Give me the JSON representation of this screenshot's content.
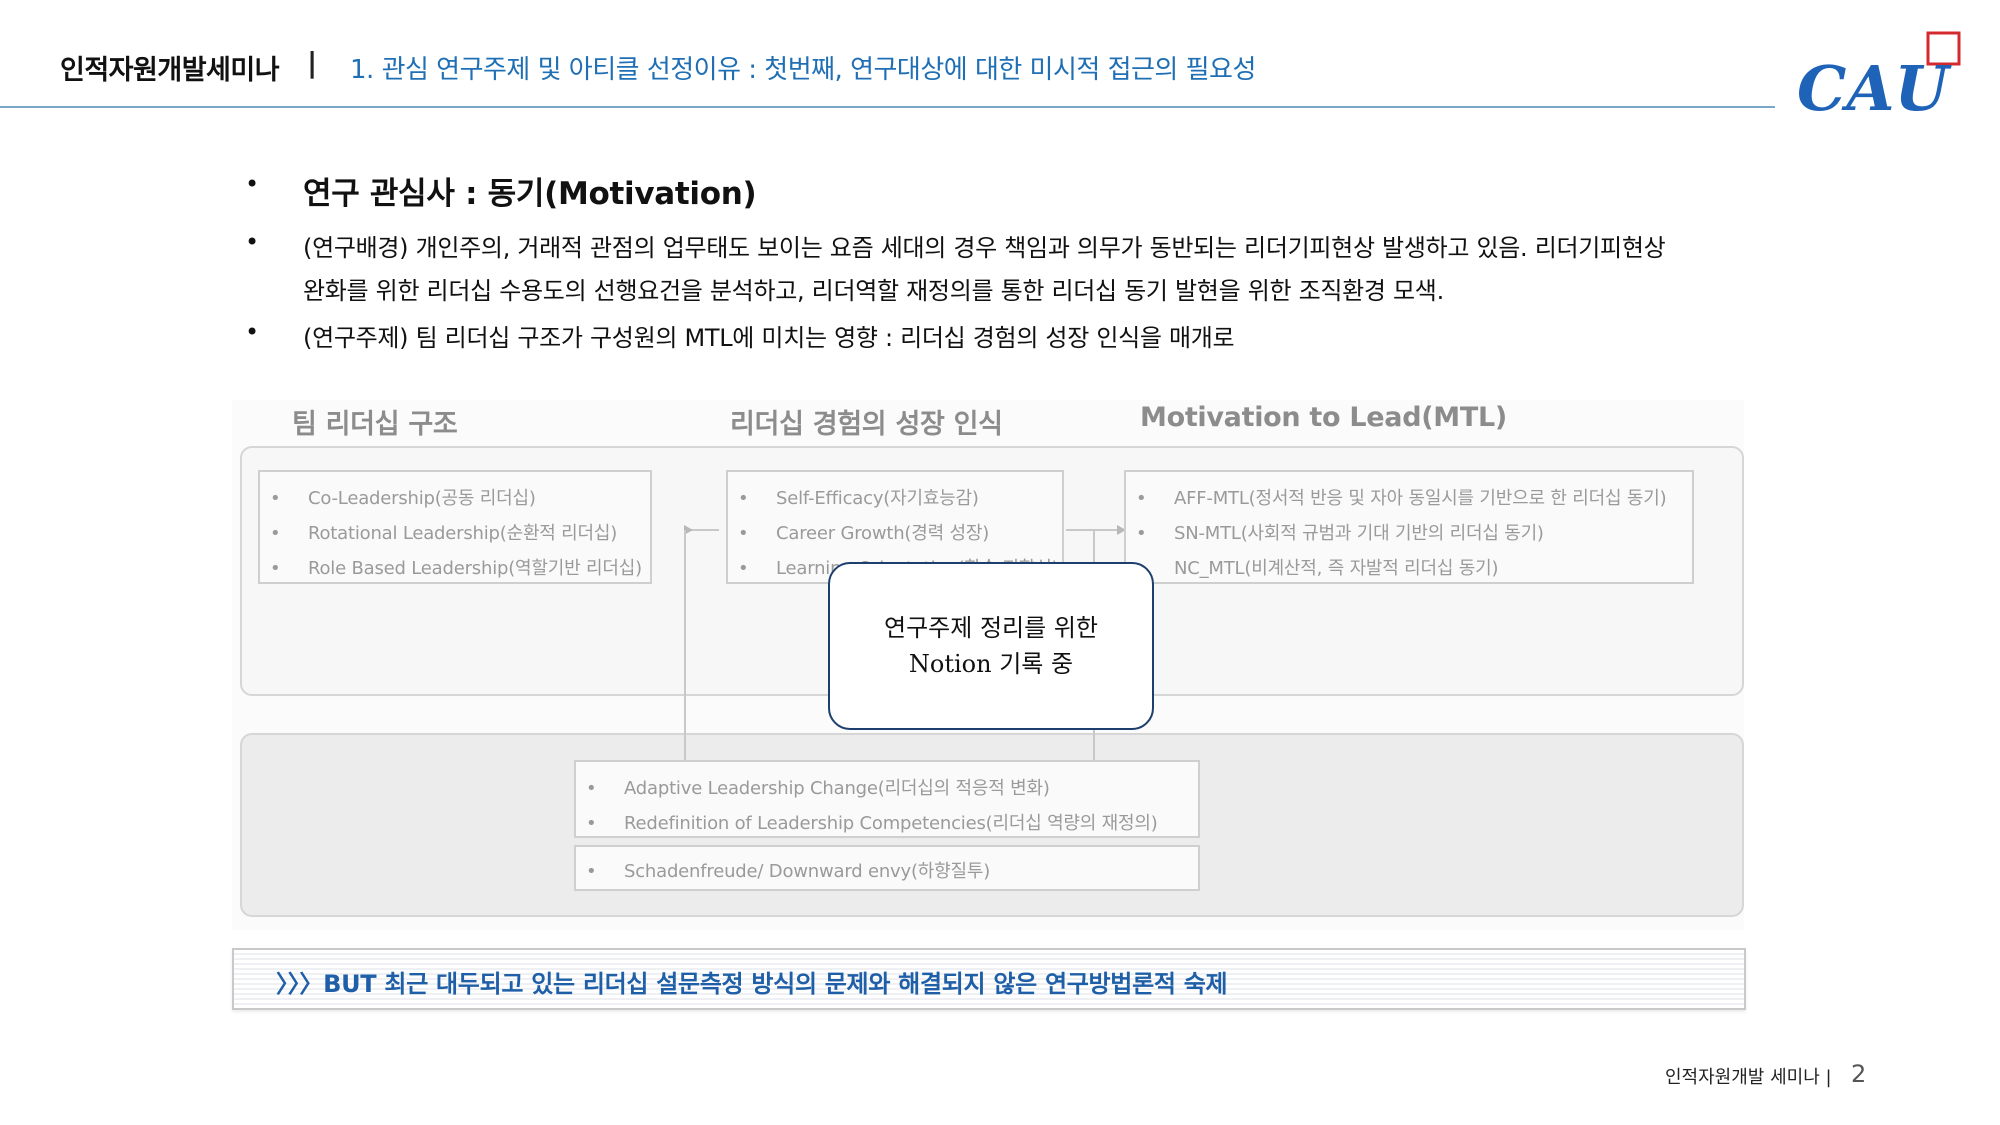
{
  "header": {
    "title": "인적자원개발세미나",
    "separator": "|",
    "subtitle": "1. 관심 연구주제 및 아티클 선정이유 : 첫번째, 연구대상에 대한 미시적 접근의 필요성",
    "logo_text": "CAU"
  },
  "bullets": {
    "dot": "•",
    "b1": "연구 관심사 : 동기(Motivation)",
    "b2_line1": "(연구배경) 개인주의, 거래적 관점의 업무태도 보이는 요즘 세대의 경우 책임과 의무가 동반되는 리더기피현상 발생하고 있음. 리더기피현상",
    "b2_line2": "완화를 위한 리더십 수용도의 선행요건을 분석하고, 리더역할 재정의를 통한 리더십 동기 발현을 위한 조직환경 모색.",
    "b3": "(연구주제) 팀 리더십 구조가 구성원의 MTL에 미치는 영향 : 리더십 경험의 성장 인식을 매개로"
  },
  "diagram": {
    "col1_header": "팀 리더십 구조",
    "col2_header": "리더십 경험의 성장 인식",
    "col3_header": "Motivation to Lead(MTL)",
    "item_dot": "•",
    "box1": [
      "Co-Leadership(공동 리더십)",
      "Rotational Leadership(순환적 리더십)",
      "Role Based Leadership(역할기반 리더십)"
    ],
    "box2": [
      "Self-Efficacy(자기효능감)",
      "Career Growth(경력 성장)",
      "Learning Orientation(학습 지향성)"
    ],
    "box3": [
      "AFF-MTL(정서적 반응 및 자아 동일시를 기반으로 한 리더십 동기)",
      "SN-MTL(사회적 규범과 기대 기반의 리더십 동기)",
      "NC_MTL(비계산적, 즉 자발적 리더십 동기)"
    ],
    "box4": [
      "Adaptive Leadership Change(리더십의 적응적 변화)",
      "Redefinition of Leadership Competencies(리더십 역량의 재정의)"
    ],
    "box5": [
      "Schadenfreude/ Downward envy(하향질투)"
    ],
    "note_line1": "연구주제 정리를 위한",
    "note_line2": "Notion 기록 중"
  },
  "callout": {
    "text": "〉〉〉BUT 최근 대두되고 있는 리더십 설문측정 방식의 문제와 해결되지 않은 연구방법론적 숙제"
  },
  "footer": {
    "label": "인적자원개발 세미나 |",
    "page": "2"
  },
  "colors": {
    "accent_blue": "#1f6fb5",
    "logo_blue": "#1f63b8",
    "logo_red": "#d4282f",
    "note_border": "#1d3f6e"
  }
}
